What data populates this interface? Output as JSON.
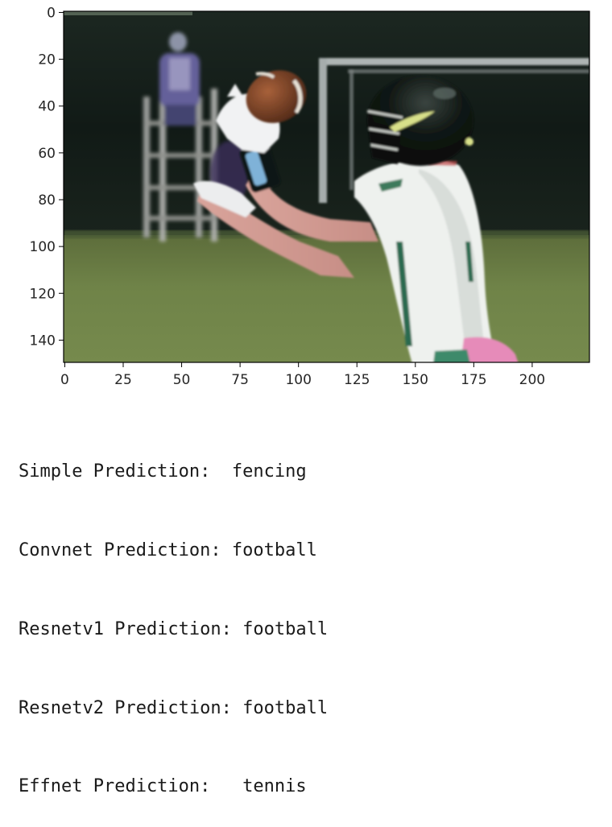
{
  "image_plot": {
    "x_ticks": [
      "0",
      "25",
      "50",
      "75",
      "100",
      "125",
      "150",
      "175",
      "200"
    ],
    "x_tick_values": [
      0,
      25,
      50,
      75,
      100,
      125,
      150,
      175,
      200
    ],
    "y_ticks": [
      "0",
      "20",
      "40",
      "60",
      "80",
      "100",
      "120",
      "140"
    ],
    "y_tick_values": [
      0,
      20,
      40,
      60,
      80,
      100,
      120,
      140
    ],
    "x_range": [
      -0.5,
      224.5
    ],
    "y_range": [
      149.5,
      -0.5
    ],
    "image": "football-receiver-catching-ball-photo"
  },
  "output": {
    "lines": [
      "Simple Prediction:  fencing",
      "Convnet Prediction: football",
      "Resnetv1 Prediction: football",
      "Resnetv2 Prediction: football",
      "Effnet Prediction:   tennis"
    ]
  },
  "colors": {
    "text": "#1a1a1a",
    "axis": "#000000",
    "field": "#6b7f45",
    "background_dark": "#15201b",
    "jersey": "#ecf0ec",
    "helmet": "#0d1310",
    "ball": "#6a3b22",
    "shorts_pink": "#e889b9"
  }
}
